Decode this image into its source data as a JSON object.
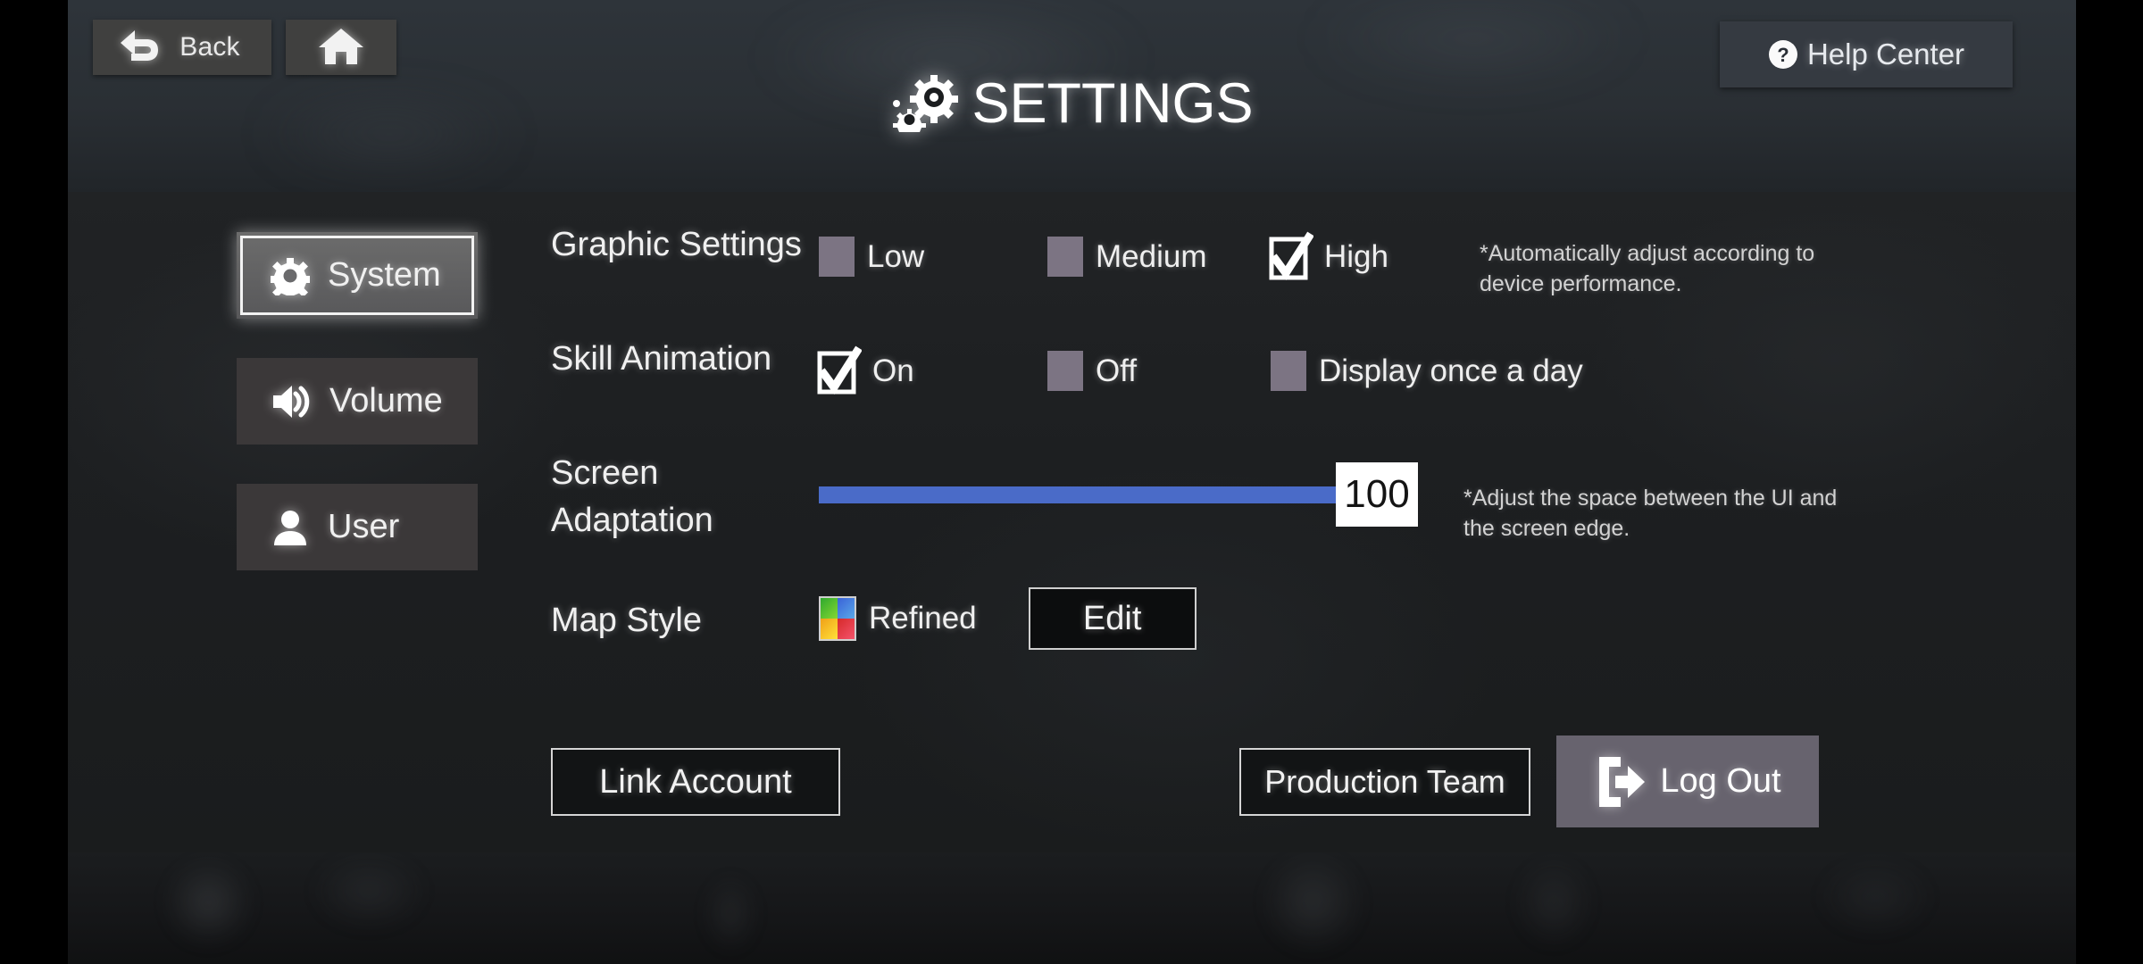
{
  "header": {
    "back_label": "Back",
    "back_icon": "back-arrow-icon",
    "home_icon": "home-icon",
    "title": "SETTINGS",
    "title_icon": "gear-icon",
    "help_label": "Help Center",
    "help_icon": "question-mark-icon"
  },
  "sidebar": {
    "items": [
      {
        "label": "System",
        "icon": "gear-icon",
        "selected": true
      },
      {
        "label": "Volume",
        "icon": "speaker-icon",
        "selected": false
      },
      {
        "label": "User",
        "icon": "person-icon",
        "selected": false
      }
    ]
  },
  "settings": {
    "graphic": {
      "label": "Graphic Settings",
      "options": [
        {
          "label": "Low",
          "checked": false
        },
        {
          "label": "Medium",
          "checked": false
        },
        {
          "label": "High",
          "checked": true
        }
      ],
      "hint": "*Automatically adjust according to\ndevice performance."
    },
    "skill_animation": {
      "label": "Skill Animation",
      "options": [
        {
          "label": "On",
          "checked": true
        },
        {
          "label": "Off",
          "checked": false
        },
        {
          "label": "Display once a day",
          "checked": false
        }
      ]
    },
    "screen_adaptation": {
      "label": "Screen Adaptation",
      "value": "100",
      "slider_percent": 100,
      "slider_color": "#4a6bc8",
      "hint": "*Adjust the space between the UI and\nthe screen edge."
    },
    "map_style": {
      "label": "Map Style",
      "value": "Refined",
      "swatch_icon": "color-palette-icon",
      "swatch_colors": [
        "#3aa82f",
        "#3a62d8",
        "#f0a017",
        "#d62a2a"
      ],
      "edit_label": "Edit"
    }
  },
  "actions": {
    "link_account": "Link Account",
    "production_team": "Production Team",
    "logout": "Log Out",
    "logout_icon": "exit-door-icon"
  }
}
